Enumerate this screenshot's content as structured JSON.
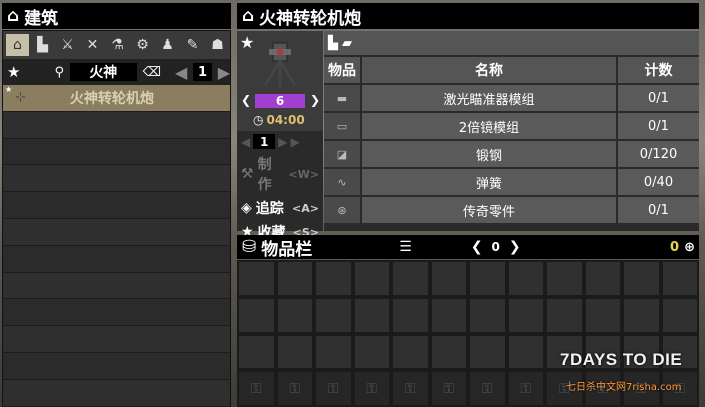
{
  "crafting": {
    "header_title": "建筑",
    "categories": [
      "home",
      "building",
      "melee",
      "tools",
      "science",
      "parts",
      "clothing",
      "medical",
      "food"
    ],
    "search_text": "火神",
    "page": "1",
    "recipes": [
      {
        "label": "火神转轮机炮"
      }
    ]
  },
  "detail": {
    "header_title": "火神转轮机炮",
    "quantity": "6",
    "craft_time": "04:00",
    "count": "1",
    "actions": {
      "craft": "制作",
      "craft_key": "<W>",
      "track": "追踪",
      "track_key": "<A>",
      "favorite": "收藏",
      "favorite_key": "<S>"
    },
    "table_headers": {
      "item": "物品",
      "name": "名称",
      "count": "计数"
    },
    "ingredients": [
      {
        "name": "激光瞄准器模组",
        "count": "0/1"
      },
      {
        "name": "2倍镜模组",
        "count": "0/1"
      },
      {
        "name": "锻钢",
        "count": "0/120"
      },
      {
        "name": "弹簧",
        "count": "0/40"
      },
      {
        "name": "传奇零件",
        "count": "0/1"
      }
    ]
  },
  "inventory": {
    "title": "物品栏",
    "page": "0",
    "currency": "0"
  },
  "watermark": {
    "logo_text": "7DAYS TO DIE",
    "site_text": "七日杀中文网7risha.com"
  },
  "colors": {
    "accent_purple": "#a23fd1",
    "header_bg": "#000000",
    "selected_row": "#8b7e60"
  }
}
